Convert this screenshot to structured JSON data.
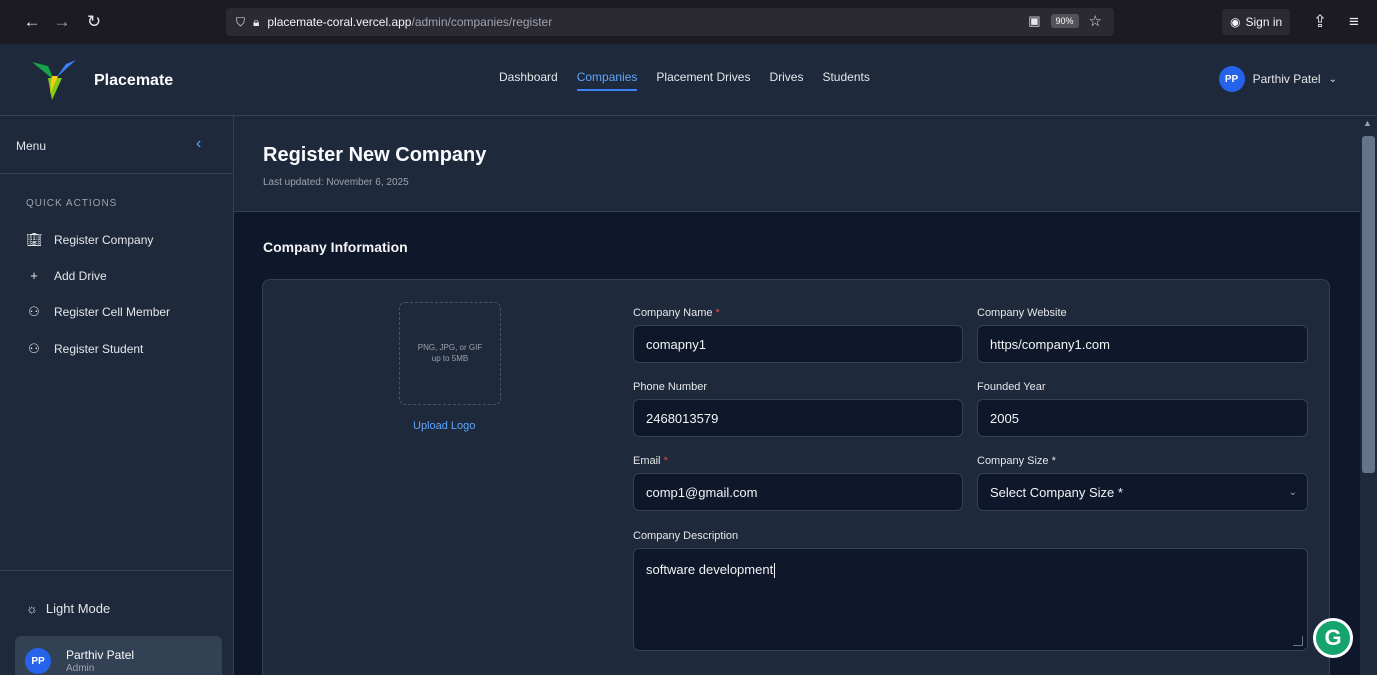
{
  "browser": {
    "url_host": "placemate-coral.vercel.app",
    "url_path": "/admin/companies/register",
    "zoom": "90%",
    "signin_label": "Sign in"
  },
  "header": {
    "brand": "Placemate",
    "nav": [
      "Dashboard",
      "Companies",
      "Placement Drives",
      "Drives",
      "Students"
    ],
    "active_nav": "Companies",
    "user_initials": "PP",
    "user_name": "Parthiv Patel"
  },
  "sidebar": {
    "menu_label": "Menu",
    "quick_actions_title": "QUICK ACTIONS",
    "items": [
      {
        "label": "Register Company",
        "icon": "building-icon"
      },
      {
        "label": "Add Drive",
        "icon": "plus-icon"
      },
      {
        "label": "Register Cell Member",
        "icon": "users-icon"
      },
      {
        "label": "Register Student",
        "icon": "users-icon"
      }
    ],
    "light_mode_label": "Light Mode",
    "user": {
      "initials": "PP",
      "name": "Parthiv Patel",
      "role": "Admin"
    }
  },
  "page": {
    "title": "Register New Company",
    "subtitle": "Last updated: November 6, 2025",
    "section_title": "Company Information"
  },
  "form": {
    "logo_hint_line1": "PNG, JPG, or GIF",
    "logo_hint_line2": "up to 5MB",
    "upload_label": "Upload Logo",
    "company_name_label": "Company Name",
    "company_name_value": "comapny1",
    "company_website_label": "Company Website",
    "company_website_value": "https/company1.com",
    "phone_label": "Phone Number",
    "phone_value": "2468013579",
    "founded_label": "Founded Year",
    "founded_value": "2005",
    "email_label": "Email",
    "email_value": "comp1@gmail.com",
    "size_label": "Company Size *",
    "size_value": "Select Company Size *",
    "description_label": "Company Description",
    "description_value": "software development",
    "required_mark": "*"
  },
  "colors": {
    "accent": "#3b82f6",
    "background": "#0f172a",
    "panel": "#1e293b",
    "required": "#ef4444"
  }
}
